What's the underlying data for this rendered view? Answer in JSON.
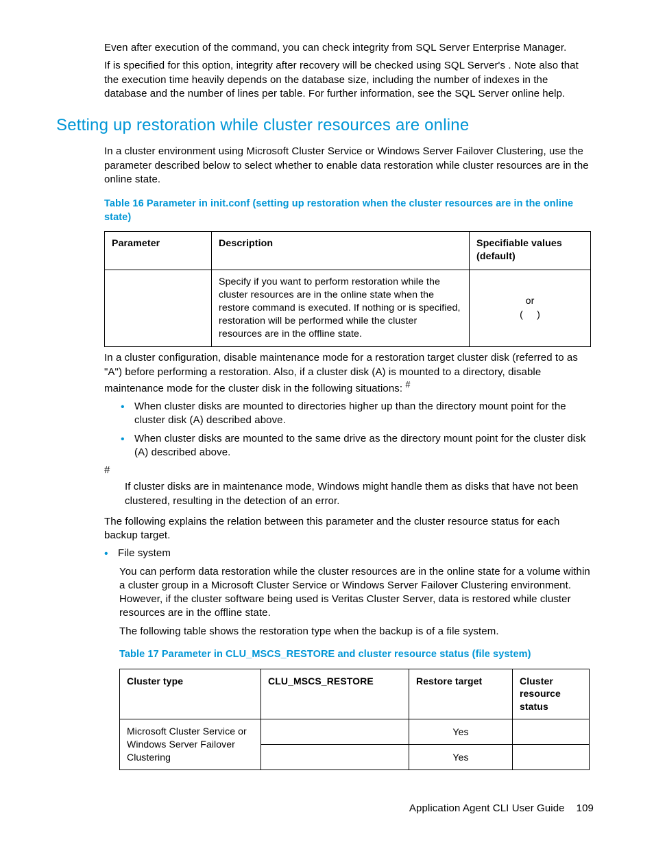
{
  "para1_a": "Even after execution of the ",
  "para1_b": " command, you can check integrity from SQL Server Enterprise Manager.",
  "para2_a": "If ",
  "para2_b": " is specified for this option, integrity after recovery will be checked using SQL Server's ",
  "para2_c": ". Note also that the ",
  "para2_d": " execution time heavily depends on the database size, including the number of indexes in the database and the number of lines per table. For further information, see the SQL Server online help.",
  "section_heading": "Setting up restoration while cluster resources are online",
  "para3": "In a cluster environment using Microsoft Cluster Service or Windows Server Failover Clustering, use the parameter described below to select whether to enable data restoration while cluster resources are in the online state.",
  "table16_caption": "Table 16 Parameter in init.conf (setting up restoration when the cluster resources are in the online state)",
  "t16_h1": "Parameter",
  "t16_h2": "Description",
  "t16_h3": "Specifiable values (default)",
  "t16_r1c1": "",
  "t16_r1c2_a": "Specify ",
  "t16_r1c2_b": " if you want to perform restoration while the cluster resources are in the online state when the restore command is executed. If nothing or ",
  "t16_r1c2_c": " is specified, restoration will be performed while the cluster resources are in the offline state.",
  "t16_r1c3_a": " or ",
  "t16_r1c3_b": "(",
  "t16_r1c3_c": ")",
  "para4": "In a cluster configuration, disable maintenance mode for a restoration target cluster disk (referred to as \"A\") before performing a restoration. Also, if a cluster disk (A) is mounted to a directory, disable maintenance mode for the cluster disk in the following situations: ",
  "para4_hash": "#",
  "bullet1": "When cluster disks are mounted to directories higher up than the directory mount point for the cluster disk (A) described above.",
  "bullet2": "When cluster disks are mounted to the same drive as the directory mount point for the cluster disk (A) described above.",
  "hashmark": "#",
  "hashtext": "If cluster disks are in maintenance mode, Windows might handle them as disks that have not been clustered, resulting in the detection of an error.",
  "para5": "The following explains the relation between this parameter and the cluster resource status for each backup target.",
  "bullet3_label": "File system",
  "bullet3_para1": "You can perform data restoration while the cluster resources are in the online state for a volume within a cluster group in a Microsoft Cluster Service or Windows Server Failover Clustering environment. However, if the cluster software being used is Veritas Cluster Server, data is restored while cluster resources are in the offline state.",
  "bullet3_para2": "The following table shows the restoration type when the backup is of a file system.",
  "table17_caption": "Table 17 Parameter in CLU_MSCS_RESTORE and cluster resource status (file system)",
  "t17_h1": "Cluster type",
  "t17_h2": "CLU_MSCS_RESTORE",
  "t17_h3": "Restore target",
  "t17_h4": "Cluster resource status",
  "t17_r1c1": "Microsoft Cluster Service or Windows Server Failover Clustering",
  "t17_r1c2": "",
  "t17_r1c3": "Yes",
  "t17_r1c4": "",
  "t17_r2c2": "",
  "t17_r2c3": "Yes",
  "t17_r2c4": "",
  "footer_text": "Application Agent CLI User Guide",
  "footer_page": "109"
}
